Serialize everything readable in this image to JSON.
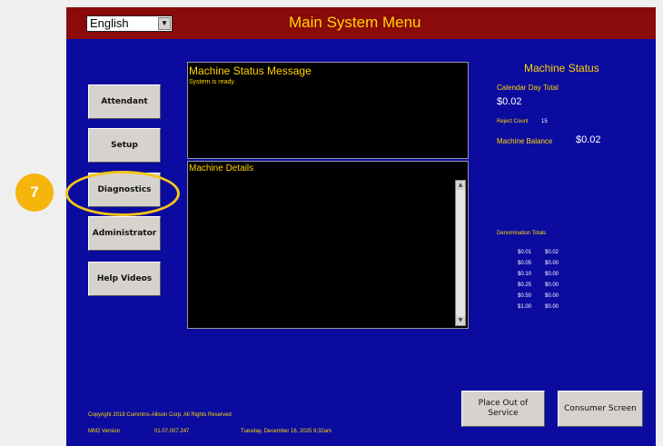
{
  "header": {
    "language": "English",
    "title": "Main System Menu"
  },
  "nav": {
    "attendant": "Attendant",
    "setup": "Setup",
    "diagnostics": "Diagnostics",
    "administrator": "Administrator",
    "help_videos": "Help Videos"
  },
  "status_message": {
    "title": "Machine Status Message",
    "text": "System is ready."
  },
  "details": {
    "title": "Machine Details"
  },
  "machine_status": {
    "title": "Machine Status",
    "calendar_day_total_label": "Calendar Day Total",
    "calendar_day_total_value": "$0.02",
    "reject_count_label": "Reject Count",
    "reject_count_value": "15",
    "machine_balance_label": "Machine Balance",
    "machine_balance_value": "$0.02",
    "denomination_totals_label": "Denomination Totals",
    "denominations": [
      {
        "denom": "$0.01",
        "total": "$0.02"
      },
      {
        "denom": "$0.05",
        "total": "$0.00"
      },
      {
        "denom": "$0.10",
        "total": "$0.00"
      },
      {
        "denom": "$0.25",
        "total": "$0.00"
      },
      {
        "denom": "$0.50",
        "total": "$0.00"
      },
      {
        "denom": "$1.00",
        "total": "$0.00"
      }
    ]
  },
  "buttons": {
    "place_out_of_service": "Place Out of Service",
    "consumer_screen": "Consumer Screen"
  },
  "footer": {
    "copyright": "Copyright 2018 Cummins-Allison Corp. All Rights Reserved",
    "version_label": "MM2 Version",
    "version_value": "01.07.007.247",
    "datetime": "Tuesday, December 16, 2025 9:32am"
  },
  "annotation": {
    "step_number": "7"
  },
  "colors": {
    "screen_bg": "#0b0ba0",
    "title_bar": "#8b0a0a",
    "accent_text": "#ffd400",
    "highlight": "#f5c518"
  }
}
